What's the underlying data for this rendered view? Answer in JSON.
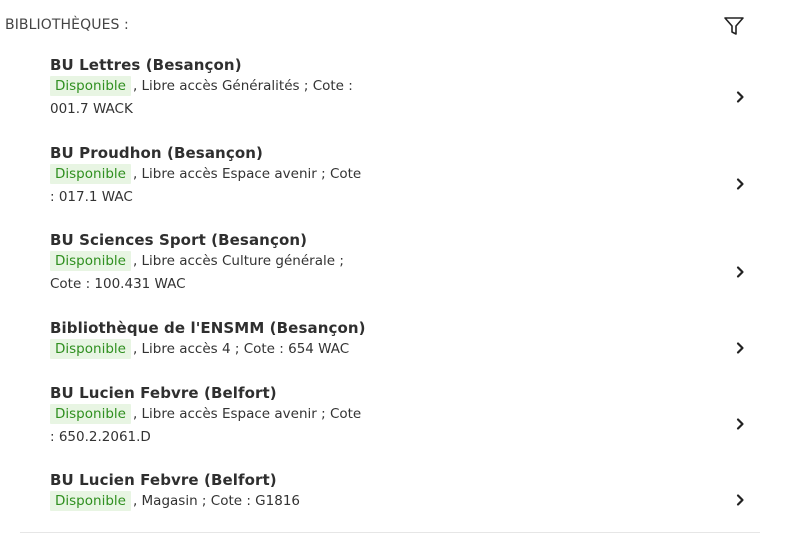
{
  "header": {
    "title": "BIBLIOTHÈQUES :",
    "filter_icon": "filter-icon"
  },
  "holdings": [
    {
      "library": "BU Lettres (Besançon)",
      "status": "Disponible",
      "details": ", Libre accès Généralités ; Cote : 001.7 WACK"
    },
    {
      "library": "BU Proudhon (Besançon)",
      "status": "Disponible",
      "details": ", Libre accès Espace avenir ; Cote : 017.1 WAC"
    },
    {
      "library": "BU Sciences Sport (Besançon)",
      "status": "Disponible",
      "details": ", Libre accès Culture générale ; Cote : 100.431 WAC"
    },
    {
      "library": "Bibliothèque de l'ENSMM (Besançon)",
      "status": "Disponible",
      "details": ", Libre accès 4 ; Cote : 654 WAC"
    },
    {
      "library": "BU Lucien Febvre (Belfort)",
      "status": "Disponible",
      "details": ", Libre accès Espace avenir ; Cote : 650.2.2061.D"
    },
    {
      "library": "BU Lucien Febvre (Belfort)",
      "status": "Disponible",
      "details": ", Magasin ; Cote : G1816"
    }
  ],
  "colors": {
    "available_text": "#2f8f1f",
    "available_background": "#e8f5e3"
  },
  "icons": {
    "row_action": "chevron-right-icon"
  }
}
